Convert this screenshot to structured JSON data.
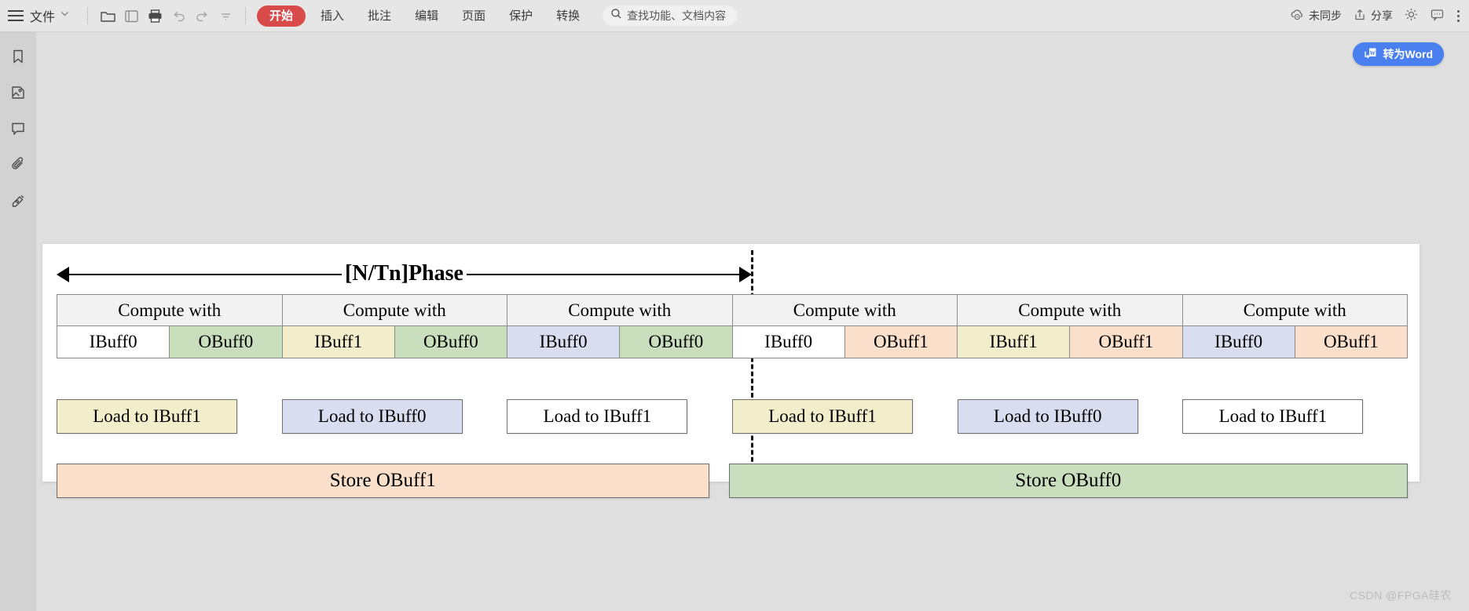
{
  "toolbar": {
    "menu_icon": "hamburger-icon",
    "file_label": "文件",
    "quick_icons": [
      "open-folder-icon",
      "new-document-icon",
      "print-icon",
      "undo-icon",
      "redo-icon",
      "more-quick-icon"
    ],
    "tabs": [
      {
        "label": "开始",
        "active": true
      },
      {
        "label": "插入",
        "active": false
      },
      {
        "label": "批注",
        "active": false
      },
      {
        "label": "编辑",
        "active": false
      },
      {
        "label": "页面",
        "active": false
      },
      {
        "label": "保护",
        "active": false
      },
      {
        "label": "转换",
        "active": false
      }
    ],
    "search": {
      "icon": "search-icon",
      "placeholder": "查找功能、文档内容",
      "value": "查找功能、文档内容"
    },
    "right_items": [
      {
        "icon": "cloud-sync-off-icon",
        "label": "未同步"
      },
      {
        "icon": "share-icon",
        "label": "分享"
      },
      {
        "icon": "gear-icon",
        "label": ""
      },
      {
        "icon": "comment-icon",
        "label": ""
      }
    ],
    "kebab": "more-options-icon",
    "accent_color": "#d94b4b",
    "bg_color": "#e6e6e6"
  },
  "rail": {
    "items": [
      {
        "icon": "bookmark-icon",
        "name": "bookmarks"
      },
      {
        "icon": "image-icon",
        "name": "images"
      },
      {
        "icon": "comment-icon",
        "name": "comments"
      },
      {
        "icon": "paperclip-icon",
        "name": "attachments"
      },
      {
        "icon": "signature-pen-icon",
        "name": "signature"
      }
    ]
  },
  "canvas": {
    "convert_button": {
      "icon": "convert-to-word-icon",
      "label": "转为Word",
      "color": "#4a7ff0"
    },
    "watermark": "CSDN @FPGA硅农"
  },
  "diagram": {
    "phase_label": "[N/Tn]Phase",
    "compute_label": "Compute with",
    "columns": [
      {
        "compute": "Compute with",
        "ibuff": "IBuff0",
        "ibuff_color": "#ffffff",
        "obuff": "OBuff0",
        "obuff_color": "#c9debc"
      },
      {
        "compute": "Compute with",
        "ibuff": "IBuff1",
        "ibuff_color": "#f2edcb",
        "obuff": "OBuff0",
        "obuff_color": "#c9debc"
      },
      {
        "compute": "Compute with",
        "ibuff": "IBuff0",
        "ibuff_color": "#d8ddef",
        "obuff": "OBuff0",
        "obuff_color": "#c9debc"
      },
      {
        "compute": "Compute with",
        "ibuff": "IBuff0",
        "ibuff_color": "#ffffff",
        "obuff": "OBuff1",
        "obuff_color": "#fadfcb"
      },
      {
        "compute": "Compute with",
        "ibuff": "IBuff1",
        "ibuff_color": "#f2edcb",
        "obuff": "OBuff1",
        "obuff_color": "#fadfcb"
      },
      {
        "compute": "Compute with",
        "ibuff": "IBuff0",
        "ibuff_color": "#d8ddef",
        "obuff": "OBuff1",
        "obuff_color": "#fadfcb"
      }
    ],
    "loads": [
      {
        "label": "Load to IBuff1",
        "color": "#f2edcb"
      },
      {
        "label": "Load to IBuff0",
        "color": "#d8ddef"
      },
      {
        "label": "Load to IBuff1",
        "color": "#ffffff"
      },
      {
        "label": "Load to IBuff1",
        "color": "#f2edcb"
      },
      {
        "label": "Load to IBuff0",
        "color": "#d8ddef"
      },
      {
        "label": "Load to IBuff1",
        "color": "#ffffff"
      }
    ],
    "stores": [
      {
        "label": "Store OBuff1",
        "color": "#fadfcb",
        "width_pct": 49
      },
      {
        "label": "Store OBuff0",
        "color": "#c9debc",
        "width_pct": 51
      }
    ]
  }
}
